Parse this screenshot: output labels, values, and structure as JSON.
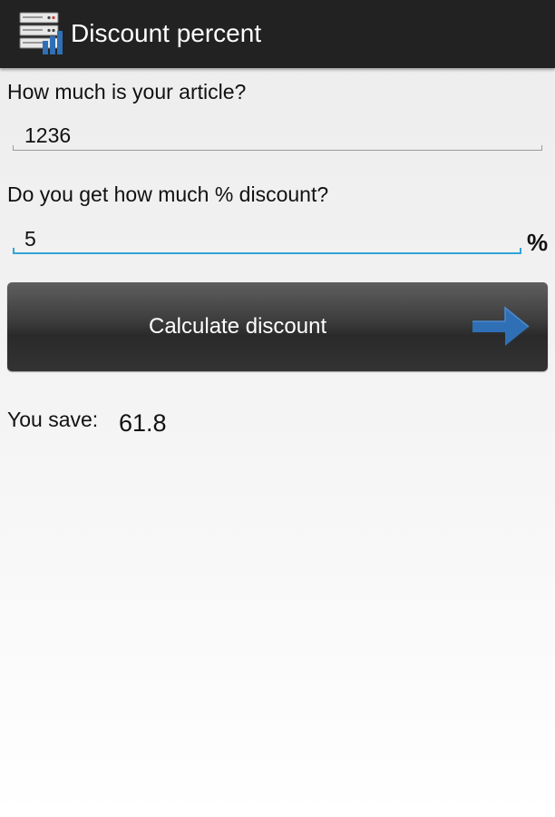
{
  "app": {
    "title": "Discount percent",
    "icon": "server-chart-icon"
  },
  "form": {
    "price_label": "How much is your article?",
    "price_value": "1236",
    "discount_label": "Do you get how much % discount?",
    "discount_value": "5",
    "percent_suffix": "%"
  },
  "button": {
    "label": "Calculate discount",
    "icon": "arrow-right-icon"
  },
  "result": {
    "label": "You save:",
    "value": "61.8"
  },
  "colors": {
    "action_bar": "#222222",
    "focus_underline": "#2fa5d6",
    "arrow": "#2f6fb5"
  }
}
